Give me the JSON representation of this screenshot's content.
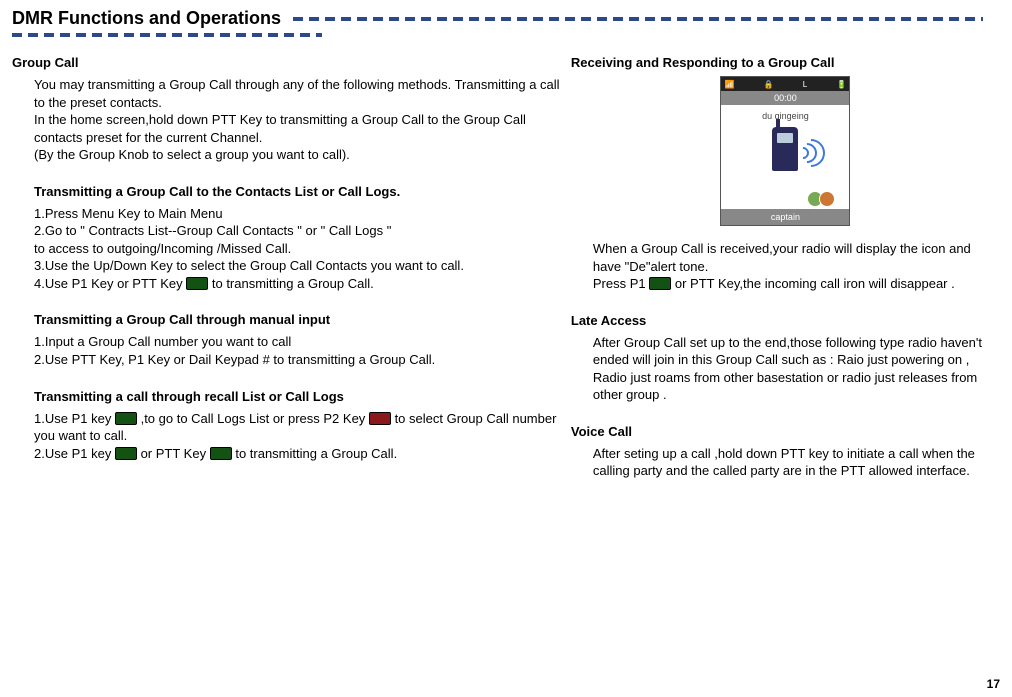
{
  "page_title": "DMR Functions and Operations",
  "page_number": "17",
  "left": {
    "group_call": {
      "heading": "Group Call",
      "body": "You may transmitting a Group Call through any of the following methods. Transmitting a call to the preset contacts.\nIn the home screen,hold down PTT Key to transmitting a Group Call to the Group Call contacts preset for the current Channel.\n(By the Group Knob to select a group you want to call)."
    },
    "contacts": {
      "heading": "Transmitting a Group Call to the Contacts List or Call Logs.",
      "l1": "1.Press Menu Key to Main Menu",
      "l2": "2.Go to \" Contracts List--Group Call Contacts \" or \" Call Logs \"\nto access to outgoing/Incoming /Missed Call.",
      "l3": "3.Use the Up/Down Key to select the Group Call Contacts you want to call.",
      "l4a": "4.Use P1 Key or PTT Key",
      "l4b": "to transmitting a Group Call."
    },
    "manual": {
      "heading": "Transmitting a Group Call through manual input",
      "l1": "1.Input a Group Call number you want to call",
      "l2": "2.Use PTT Key, P1 Key or Dail Keypad # to transmitting a Group Call."
    },
    "recall": {
      "heading": "Transmitting a call through  recall List or Call Logs",
      "l1a": "1.Use P1 key",
      "l1b": ",to go to Call Logs List or press P2 Key",
      "l1c": "to select Group Call number you want to call.",
      "l2a": "2.Use P1 key ",
      "l2b": " or PTT Key",
      "l2c": "to transmitting a Group Call."
    }
  },
  "right": {
    "receive": {
      "heading": "Receiving and Responding to a Group Call",
      "screen": {
        "status_l": "L",
        "time": "00:00",
        "caller": "du qingeing",
        "bottom": "captain"
      },
      "body_a": "When a Group Call is received,your radio will display the icon and have \"De\"alert tone.",
      "body_b1": "Press P1",
      "body_b2": "or PTT Key,the incoming call iron will disappear ."
    },
    "late": {
      "heading": "Late Access",
      "body": "After Group Call set up to the end,those following type radio haven't ended will join in this Group Call such as : Raio just powering on , Radio just roams from other basestation or radio just releases from other group ."
    },
    "voice": {
      "heading": "Voice Call",
      "body": "After seting up a call ,hold down PTT key to initiate a call when the calling party and  the called party are in the PTT allowed interface."
    }
  }
}
